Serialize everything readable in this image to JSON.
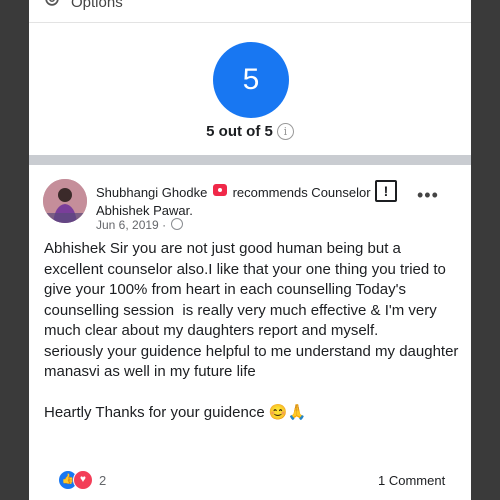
{
  "options": {
    "label": "Options"
  },
  "rating": {
    "value": "5",
    "summary": "5 out of 5",
    "info_glyph": "i"
  },
  "post": {
    "author": "Shubhangi Ghodke",
    "action": "recommends Counselor Abhishek Pawar.",
    "date": "Jun 6, 2019",
    "separator": "·",
    "report_glyph": "!",
    "more_glyph": "•••",
    "body": [
      "Abhishek Sir you are not just good human being but a excellent counselor also.I like that your one thing you tried to give your 100% from heart in each counselling Today's counselling session  is really very much effective & I'm very much clear about my daughters report and myself.",
      "seriously your guidence helpful to me understand my daughter manasvi as well in my future life",
      "",
      "Heartly Thanks for your guidence 😊🙏"
    ],
    "reactions_count": "2",
    "comments": "1 Comment"
  },
  "colors": {
    "accent": "#1877f2",
    "love": "#f33e58",
    "badge": "#f02849",
    "divider": "#c9ccd1"
  },
  "icons": [
    "gear-icon",
    "info-icon",
    "recommend-badge-icon",
    "report-icon",
    "more-icon",
    "globe-icon",
    "like-icon",
    "love-icon"
  ]
}
